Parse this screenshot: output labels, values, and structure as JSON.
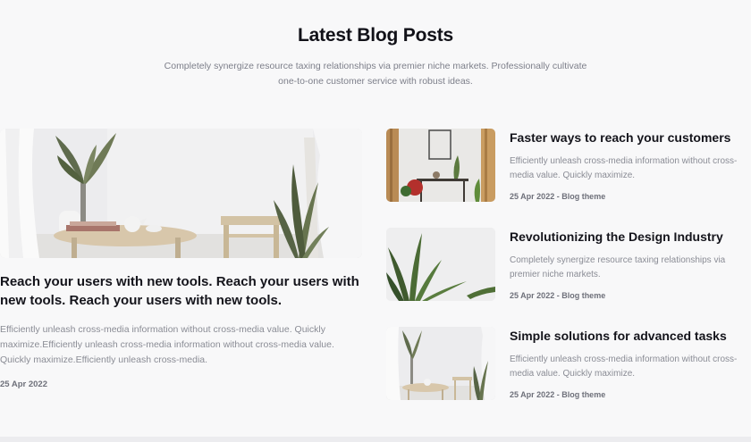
{
  "section": {
    "title": "Latest Blog Posts",
    "subtitle_line1": "Completely synergize resource taxing relationships via premier niche markets. Professionally cultivate",
    "subtitle_line2": "one-to-one customer service with robust ideas."
  },
  "featured_post": {
    "image_icon": "room-interior-photo",
    "title": "Reach your users with new tools. Reach your users with new tools. Reach your users with new tools.",
    "description": "Efficiently unleash cross-media information without cross-media value. Quickly maximize.Efficiently unleash cross-media information without cross-media value. Quickly maximize.Efficiently unleash cross-media.",
    "date": "25 Apr 2022"
  },
  "posts": [
    {
      "image_icon": "hallway-console-photo",
      "title": "Faster ways to reach your customers",
      "description": "Efficiently unleash cross-media information without cross-media value. Quickly maximize.",
      "meta": "25 Apr 2022 - Blog theme"
    },
    {
      "image_icon": "plant-leaves-photo",
      "title": "Revolutionizing the Design Industry",
      "description": "Completely synergize resource taxing relationships via premier niche markets.",
      "meta": "25 Apr 2022 - Blog theme"
    },
    {
      "image_icon": "room-interior-photo",
      "title": "Simple solutions for advanced tasks",
      "description": "Efficiently unleash cross-media information without cross-media value. Quickly maximize.",
      "meta": "25 Apr 2022 - Blog theme"
    }
  ],
  "colors": {
    "background": "#f8f8f9",
    "heading": "#111118",
    "body_text": "#8a8c95",
    "meta_text": "#6e707a"
  }
}
